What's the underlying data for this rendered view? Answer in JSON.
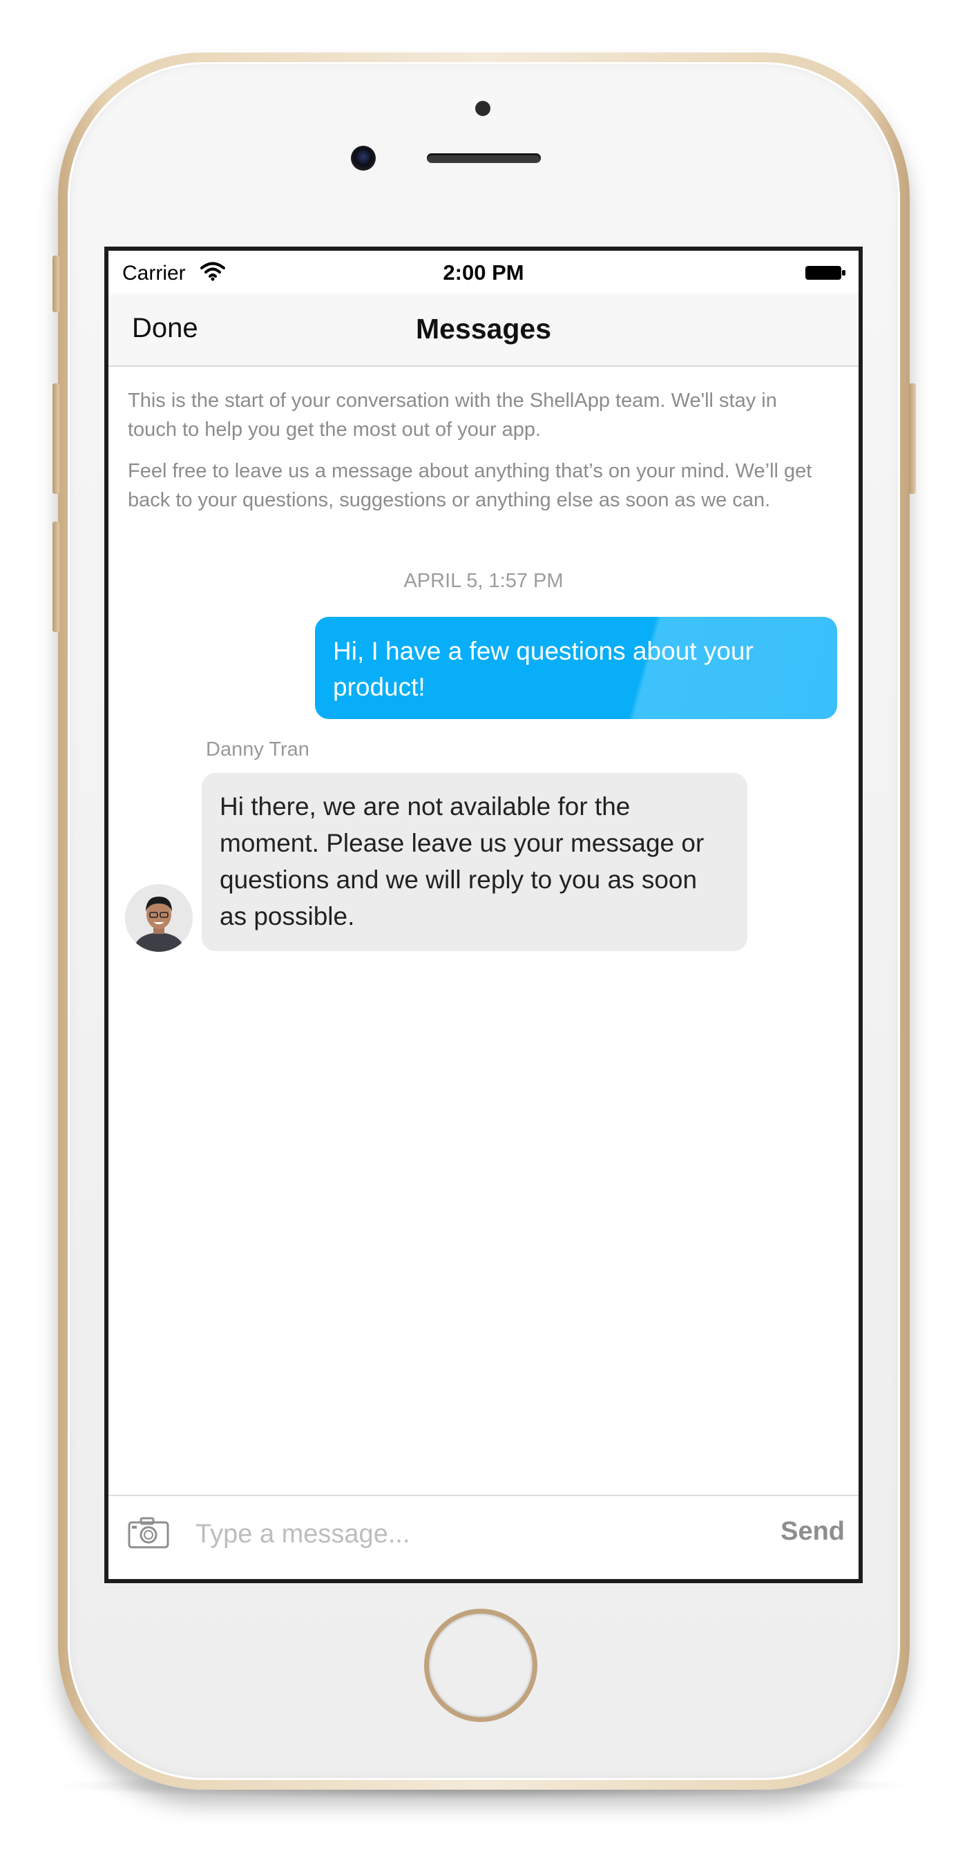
{
  "status_bar": {
    "carrier": "Carrier",
    "time": "2:00 PM",
    "wifi_icon": "wifi-icon",
    "battery_icon": "battery-icon"
  },
  "nav": {
    "done_label": "Done",
    "title": "Messages"
  },
  "intro": {
    "paragraph_1": "This is the start of your conversation with the ShellApp team. We'll stay in touch to help you get the most out of your app.",
    "paragraph_2": "Feel free to leave us a message about anything that’s on your mind. We’ll get back to your questions, suggestions or anything else as soon as we can."
  },
  "conversation": {
    "timestamp": "APRIL 5, 1:57 PM",
    "outgoing_message": "Hi, I have a few questions about your product!",
    "sender_name": "Danny Tran",
    "incoming_message": "Hi there, we are not available for the moment. Please leave us your message or questions and we will reply to you as soon as possible.",
    "avatar_icon": "avatar"
  },
  "composer": {
    "camera_icon": "camera-icon",
    "placeholder": "Type a message...",
    "value": "",
    "send_label": "Send"
  },
  "colors": {
    "accent": "#08aef7",
    "incoming_bubble": "#ececec",
    "device_frame": "#e7d3b3"
  }
}
